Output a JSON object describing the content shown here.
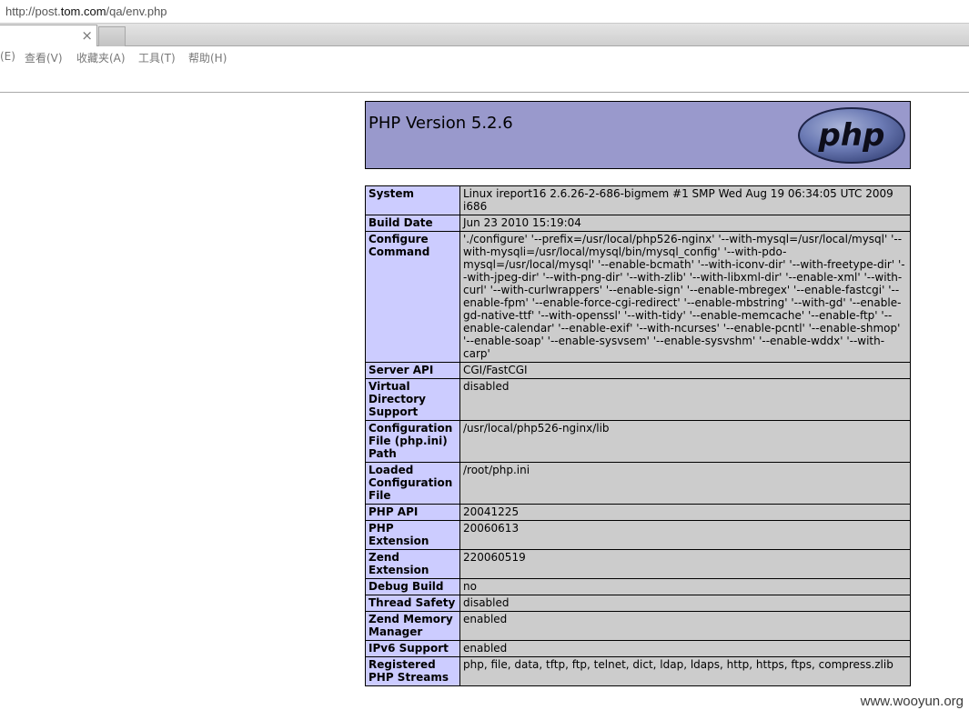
{
  "browser": {
    "url_prefix": "http://post.",
    "url_host": "tom.com",
    "url_path": "/qa/env.php",
    "tab_close": "×",
    "menus": [
      "(E)",
      "查看(V)",
      "收藏夹(A)",
      "工具(T)",
      "帮助(H)"
    ]
  },
  "phpinfo": {
    "version_title": "PHP Version 5.2.6",
    "logo_text": "php",
    "rows": [
      {
        "label": "System",
        "value": "Linux ireport16 2.6.26-2-686-bigmem #1 SMP Wed Aug 19 06:34:05 UTC 2009 i686"
      },
      {
        "label": "Build Date",
        "value": "Jun 23 2010 15:19:04"
      },
      {
        "label": "Configure Command",
        "value": "'./configure' '--prefix=/usr/local/php526-nginx' '--with-mysql=/usr/local/mysql' '--with-mysqli=/usr/local/mysql/bin/mysql_config' '--with-pdo-mysql=/usr/local/mysql' '--enable-bcmath' '--with-iconv-dir' '--with-freetype-dir' '--with-jpeg-dir' '--with-png-dir' '--with-zlib' '--with-libxml-dir' '--enable-xml' '--with-curl' '--with-curlwrappers' '--enable-sign' '--enable-mbregex' '--enable-fastcgi' '--enable-fpm' '--enable-force-cgi-redirect' '--enable-mbstring' '--with-gd' '--enable-gd-native-ttf' '--with-openssl' '--with-tidy' '--enable-memcache' '--enable-ftp' '--enable-calendar' '--enable-exif' '--with-ncurses' '--enable-pcntl' '--enable-shmop' '--enable-soap' '--enable-sysvsem' '--enable-sysvshm' '--enable-wddx' '--with-carp'"
      },
      {
        "label": "Server API",
        "value": "CGI/FastCGI"
      },
      {
        "label": "Virtual Directory Support",
        "value": "disabled"
      },
      {
        "label": "Configuration File (php.ini) Path",
        "value": "/usr/local/php526-nginx/lib"
      },
      {
        "label": "Loaded Configuration File",
        "value": "/root/php.ini"
      },
      {
        "label": "PHP API",
        "value": "20041225"
      },
      {
        "label": "PHP Extension",
        "value": "20060613"
      },
      {
        "label": "Zend Extension",
        "value": "220060519"
      },
      {
        "label": "Debug Build",
        "value": "no"
      },
      {
        "label": "Thread Safety",
        "value": "disabled"
      },
      {
        "label": "Zend Memory Manager",
        "value": "enabled"
      },
      {
        "label": "IPv6 Support",
        "value": "enabled"
      },
      {
        "label": "Registered PHP Streams",
        "value": "php, file, data, tftp, ftp, telnet, dict, ldap, ldaps, http, https, ftps, compress.zlib"
      }
    ]
  },
  "watermark": "www.wooyun.org",
  "colors": {
    "header_bg": "#9999cc",
    "label_bg": "#ccccff",
    "value_bg": "#cccccc"
  }
}
